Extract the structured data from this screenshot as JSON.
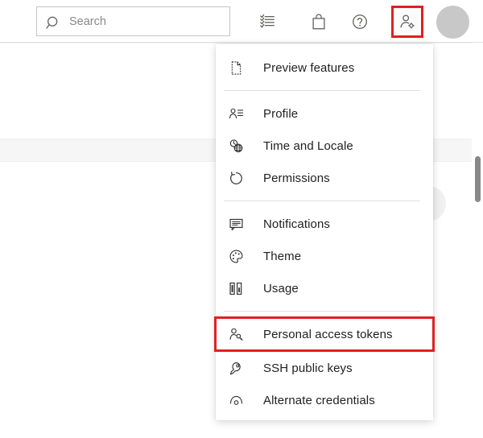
{
  "header": {
    "search": {
      "icon": "search-icon",
      "placeholder": "Search",
      "value": ""
    },
    "icons": [
      {
        "name": "work-items-icon",
        "label": "Work items"
      },
      {
        "name": "marketplace-bag-icon",
        "label": "Marketplace"
      },
      {
        "name": "help-question-icon",
        "label": "Help"
      },
      {
        "name": "user-settings-icon",
        "label": "User settings"
      }
    ],
    "avatar": {
      "name": "avatar",
      "label": "User avatar"
    }
  },
  "menu": {
    "name": "user-settings-menu",
    "groups": [
      {
        "items": [
          {
            "icon": "preview-features-icon",
            "label": "Preview features",
            "highlighted": false
          }
        ]
      },
      {
        "items": [
          {
            "icon": "profile-icon",
            "label": "Profile",
            "highlighted": false
          },
          {
            "icon": "time-and-locale-icon",
            "label": "Time and Locale",
            "highlighted": false
          },
          {
            "icon": "permissions-icon",
            "label": "Permissions",
            "highlighted": false
          }
        ]
      },
      {
        "items": [
          {
            "icon": "notifications-icon",
            "label": "Notifications",
            "highlighted": false
          },
          {
            "icon": "theme-palette-icon",
            "label": "Theme",
            "highlighted": false
          },
          {
            "icon": "usage-chart-icon",
            "label": "Usage",
            "highlighted": false
          }
        ]
      },
      {
        "items": [
          {
            "icon": "personal-access-tokens-icon",
            "label": "Personal access tokens",
            "highlighted": true
          },
          {
            "icon": "ssh-key-icon",
            "label": "SSH public keys",
            "highlighted": false
          },
          {
            "icon": "alternate-credentials-icon",
            "label": "Alternate credentials",
            "highlighted": false
          }
        ]
      }
    ]
  },
  "colors": {
    "highlight_red": "#e02020",
    "accent_orange": "#d9813c",
    "avatar_grey": "#c8c8c8",
    "band_grey": "#f6f6f6",
    "text_primary": "#201f1e",
    "icon_grey": "#605e5c"
  }
}
